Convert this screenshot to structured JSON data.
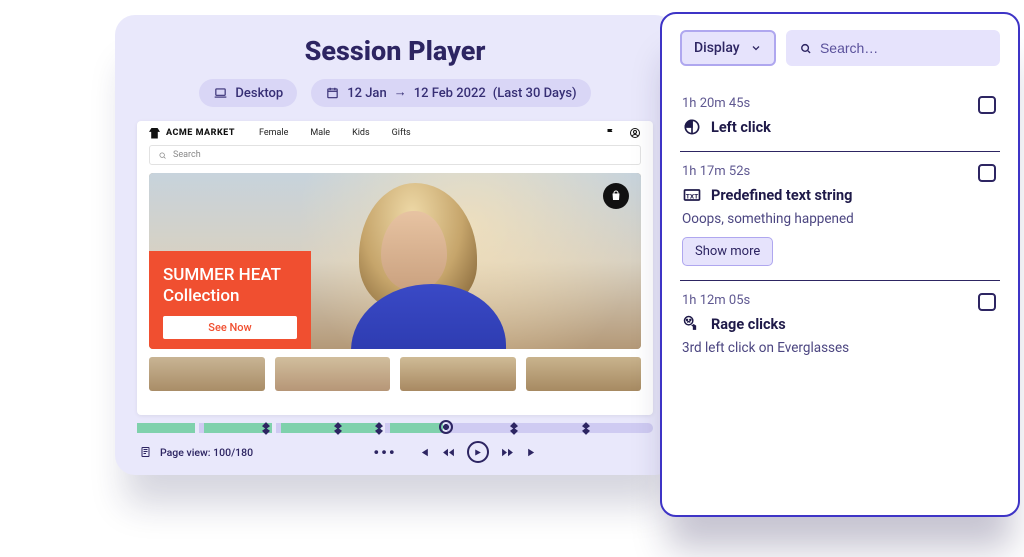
{
  "player": {
    "title": "Session Player",
    "pills": {
      "device": "Desktop",
      "dates": {
        "from": "12 Jan",
        "arrow": "→",
        "to": "12 Feb 2022",
        "range": "(Last 30 Days)"
      }
    }
  },
  "site": {
    "brand": "ACME MARKET",
    "nav": {
      "a": "Female",
      "b": "Male",
      "c": "Kids",
      "d": "Gifts"
    },
    "search_placeholder": "Search",
    "hero_title": "SUMMER HEAT Collection",
    "hero_cta": "See Now"
  },
  "controls": {
    "page_view": "Page view: 100/180"
  },
  "panel": {
    "display_label": "Display",
    "search_placeholder": "Search…"
  },
  "events": [
    {
      "time": "1h 20m 45s",
      "label": "Left click"
    },
    {
      "time": "1h 17m 52s",
      "label": "Predefined text string",
      "detail": "Ooops, something happened",
      "show_more": "Show more"
    },
    {
      "time": "1h 12m 05s",
      "label": "Rage clicks",
      "detail_pre": "3rd left click on ",
      "detail_hl": "",
      "detail_post": "Everglasses"
    }
  ]
}
